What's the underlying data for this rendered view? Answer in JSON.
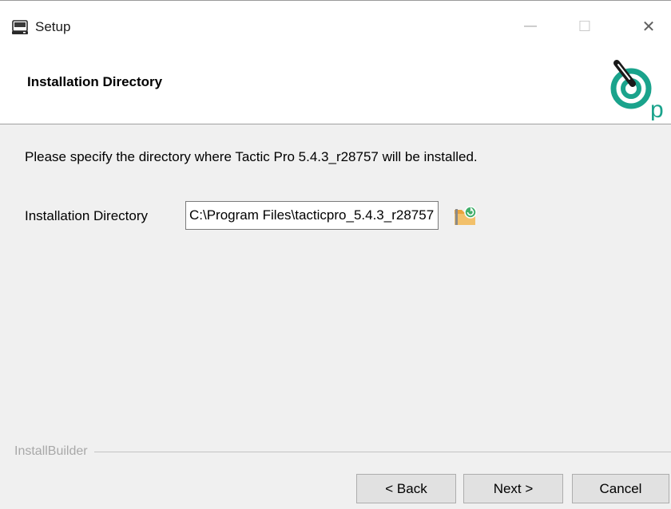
{
  "window": {
    "title": "Setup",
    "title_icon": "installer-drive-icon",
    "controls": {
      "minimize": "—",
      "maximize": "☐",
      "close": "✕"
    }
  },
  "header": {
    "title": "Installation Directory",
    "logo_icon": "tactic-pro-logo-icon",
    "logo_letter": "p"
  },
  "body": {
    "description": "Please specify the directory where Tactic Pro 5.4.3_r28757 will be installed.",
    "directory_label": "Installation Directory",
    "directory_value": "C:\\Program Files\\tacticpro_5.4.3_r28757",
    "browse_icon": "folder-browse-icon"
  },
  "footer": {
    "brand": "InstallBuilder",
    "back_label": "< Back",
    "next_label": "Next >",
    "cancel_label": "Cancel"
  },
  "colors": {
    "window_bg": "#f0f0f0",
    "header_bg": "#ffffff",
    "button_bg": "#e1e1e1",
    "logo_teal": "#1aa38c",
    "logo_dark": "#1a1a1a",
    "folder_orange": "#e8a33c",
    "folder_badge": "#3fae6a"
  }
}
